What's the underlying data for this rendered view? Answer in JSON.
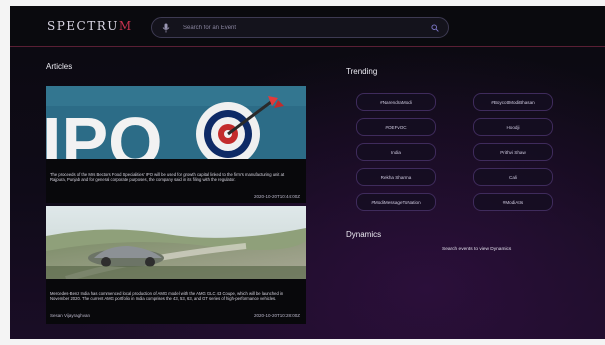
{
  "app": {
    "logo_main": "SPECTRU",
    "logo_accent": "M"
  },
  "search": {
    "placeholder": "Search for an Event"
  },
  "articles": {
    "title": "Articles",
    "items": [
      {
        "text": "The proceeds of the Mrs Bectors Food Specialities' IPO will be used for growth capital linked to the firm's manufacturing unit at Rajpura, Punjab and for general corporate purposes, the company said in its filing with the regulator.",
        "author": "",
        "timestamp": "2020-10-20T10:44:00Z"
      },
      {
        "text": "Mercedes-Benz India has commenced local production of AMG model with the AMG GLC 43 Coupe, which will be launched in November 2020. The current AMG portfolio in India comprises the 43, 53, 63, and GT series of high-performance vehicles.",
        "author": "Sesan Vijayraghvan",
        "timestamp": "2020-10-20T10:28:00Z"
      }
    ]
  },
  "trending": {
    "title": "Trending",
    "tags": [
      "#NarendraModi",
      "#BoycottModiBhasan",
      "#OEFvOC",
      "Hoodji",
      "India",
      "Prithvi Shaw",
      "Rekha Sharma",
      "Cali",
      "#ModiMessageToNation",
      "#ModiAtIs"
    ]
  },
  "dynamics": {
    "title": "Dynamics",
    "message": "Search events to view Dynamics"
  },
  "colors": {
    "accent": "#c8324e",
    "background": "#0d0b14",
    "tag_border": "#3f2b5c"
  }
}
